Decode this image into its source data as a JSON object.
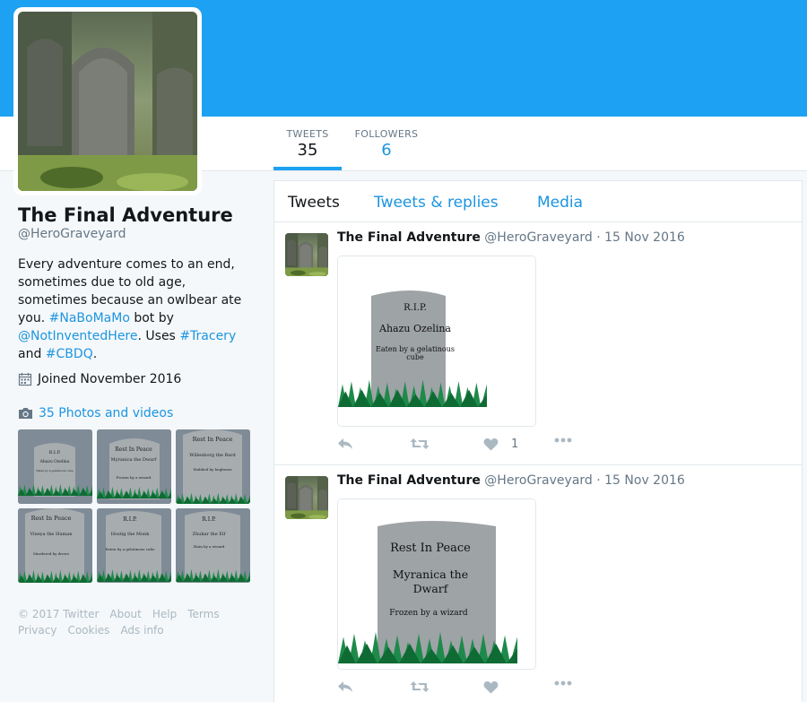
{
  "profile": {
    "name": "The Final Adventure",
    "handle": "@HeroGraveyard",
    "bio_1": "Every adventure comes to an end, sometimes due to old age, sometimes because an owlbear ate you. ",
    "bio_tag_nabomamo": "#NaBoMaMo",
    "bio_2": " bot by ",
    "bio_mention": "@NotInventedHere",
    "bio_3": ". Uses ",
    "bio_tag_tracery": "#Tracery",
    "bio_4": " and ",
    "bio_tag_cbdq": "#CBDQ",
    "bio_5": ".",
    "joined": "Joined November 2016",
    "photos_label": "35 Photos and videos"
  },
  "nav": {
    "tweets_label": "TWEETS",
    "tweets_count": "35",
    "followers_label": "FOLLOWERS",
    "followers_count": "6"
  },
  "tabs": {
    "tweets": "Tweets",
    "replies": "Tweets & replies",
    "media": "Media"
  },
  "thumbs": [
    {
      "l1": "R.I.P.",
      "l2": "Ahazu Ozelina",
      "l3": "Eaten by a gelatinous cube"
    },
    {
      "l1": "Rest In Peace",
      "l2": "Myranica the Dwarf",
      "l3": "Frozen by a wizard"
    },
    {
      "l1": "Rest In Peace",
      "l2": "Willenborg the Bard",
      "l3": "Stabbed by bugbears"
    },
    {
      "l1": "Rest In Peace",
      "l2": "Vineya the Human",
      "l3": "Murdered by drows"
    },
    {
      "l1": "R.I.P.",
      "l2": "Hostig the Monk",
      "l3": "Eaten by a gelatinous cube"
    },
    {
      "l1": "R.I.P.",
      "l2": "Zhukar the Elf",
      "l3": "Slain by a wizard"
    }
  ],
  "footer": {
    "copyright": "© 2017 Twitter",
    "about": "About",
    "help": "Help",
    "terms": "Terms",
    "privacy": "Privacy",
    "cookies": "Cookies",
    "ads": "Ads info"
  },
  "tweets": [
    {
      "name": "The Final Adventure",
      "handle_date": "@HeroGraveyard · 15 Nov 2016",
      "stone_1": "R.I.P.",
      "stone_2": "Ahazu Ozelina",
      "stone_3a": "Eaten by a gelatinous",
      "stone_3b": "cube",
      "likes": "1"
    },
    {
      "name": "The Final Adventure",
      "handle_date": "@HeroGraveyard · 15 Nov 2016",
      "stone_1": "Rest In Peace",
      "stone_2a": "Myranica the",
      "stone_2b": "Dwarf",
      "stone_3": "Frozen by a wizard",
      "likes": ""
    }
  ],
  "colors": {
    "banner": "#1da1f2",
    "link": "#1b95e0",
    "grass": "#1e8a4a",
    "stone": "#9ea3a6"
  },
  "icons": [
    "calendar-icon",
    "camera-icon",
    "reply-icon",
    "retweet-icon",
    "like-icon",
    "more-icon"
  ]
}
